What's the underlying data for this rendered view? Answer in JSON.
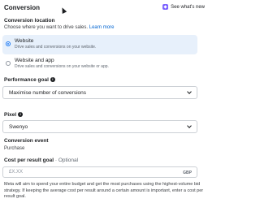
{
  "header": {
    "title": "Conversion",
    "whats_new": "See what's new"
  },
  "conversion_location": {
    "label": "Conversion location",
    "subtitle": "Choose where you want to drive sales.",
    "learn_more": "Learn more",
    "options": [
      {
        "title": "Website",
        "description": "Drive sales and conversions on your website.",
        "selected": true
      },
      {
        "title": "Website and app",
        "description": "Drive sales and conversions on your website or app.",
        "selected": false
      }
    ]
  },
  "performance_goal": {
    "label": "Performance goal",
    "value": "Maximise number of conversions"
  },
  "pixel": {
    "label": "Pixel",
    "value": "Swenyo"
  },
  "conversion_event": {
    "label": "Conversion event",
    "value": "Purchase"
  },
  "cost_per_result": {
    "label": "Cost per result goal",
    "optional": "· Optional",
    "placeholder": "£X.XX",
    "currency": "GBP"
  },
  "footer_text": "Meta will aim to spend your entire budget and get the most purchases using the highest-volume bid strategy. If keeping the average cost per result around a certain amount is important, enter a cost per result goal."
}
